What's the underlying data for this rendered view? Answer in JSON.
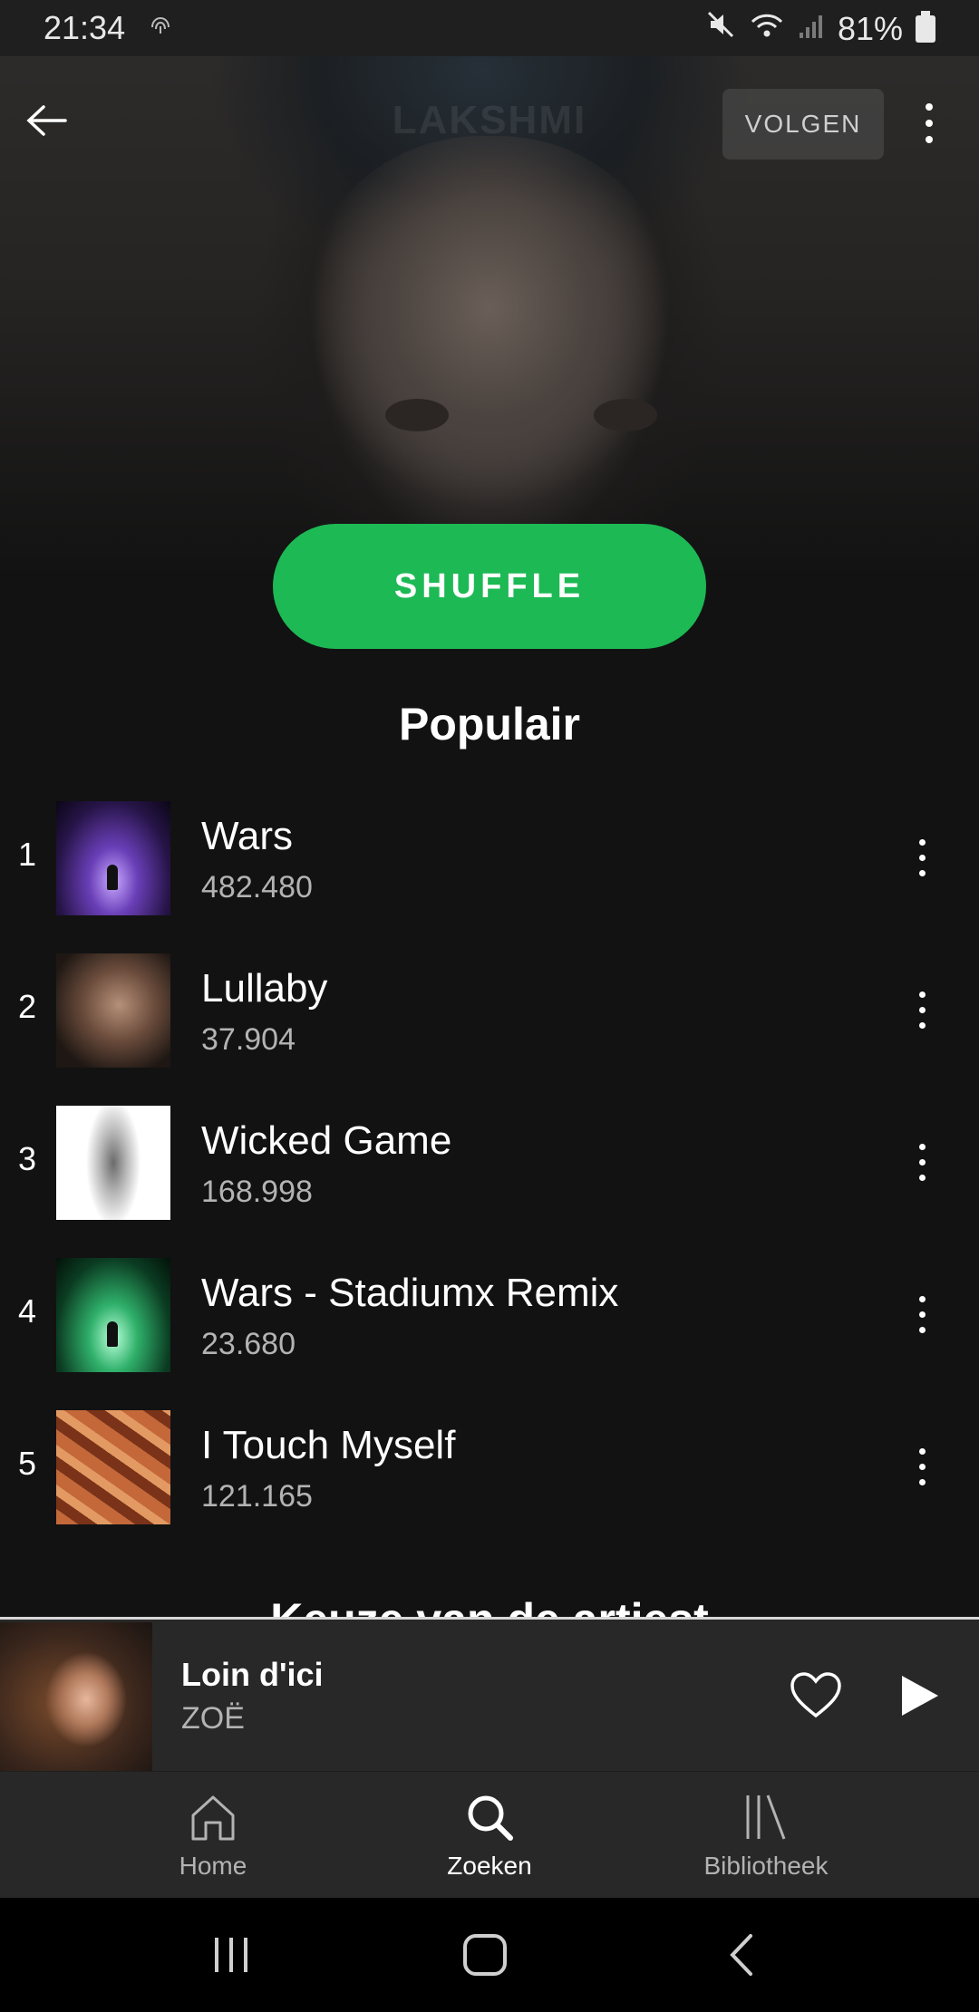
{
  "status_bar": {
    "time": "21:34",
    "battery": "81%",
    "icons": [
      "fingerprint-icon",
      "mute-icon",
      "wifi-icon",
      "signal-icon",
      "battery-icon"
    ]
  },
  "header": {
    "artist_name": "LAKSHMI",
    "follow_label": "VOLGEN"
  },
  "shuffle_label": "SHUFFLE",
  "popular": {
    "title": "Populair",
    "tracks": [
      {
        "rank": "1",
        "name": "Wars",
        "plays": "482.480"
      },
      {
        "rank": "2",
        "name": "Lullaby",
        "plays": "37.904"
      },
      {
        "rank": "3",
        "name": "Wicked Game",
        "plays": "168.998"
      },
      {
        "rank": "4",
        "name": "Wars - Stadiumx Remix",
        "plays": "23.680"
      },
      {
        "rank": "5",
        "name": "I Touch Myself",
        "plays": "121.165"
      }
    ]
  },
  "next_section_title": "Keuze van de artiest",
  "now_playing": {
    "title": "Loin d'ici",
    "artist": "ZOË"
  },
  "bottom_nav": {
    "items": [
      {
        "label": "Home",
        "icon": "home-icon"
      },
      {
        "label": "Zoeken",
        "icon": "search-icon"
      },
      {
        "label": "Bibliotheek",
        "icon": "library-icon"
      }
    ],
    "active": "Zoeken"
  },
  "colors": {
    "accent": "#1db954",
    "background": "#121212",
    "player": "#282828"
  }
}
